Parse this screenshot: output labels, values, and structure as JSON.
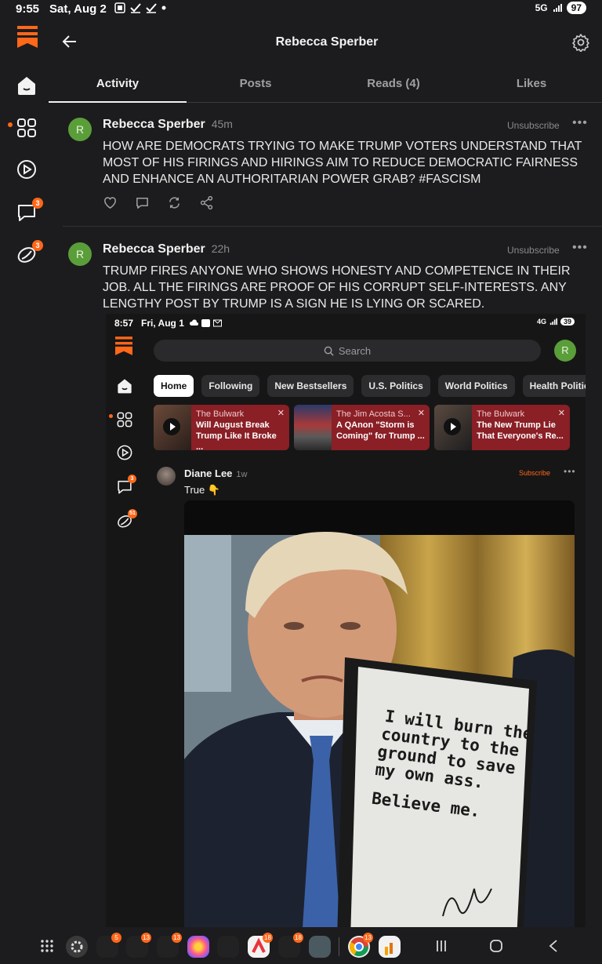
{
  "status_bar": {
    "time": "9:55",
    "date": "Sat, Aug 2",
    "network": "5G",
    "battery": "97"
  },
  "rail": {
    "badges": {
      "chat": "3",
      "activity": "3"
    }
  },
  "header": {
    "title": "Rebecca Sperber"
  },
  "tabs": [
    {
      "label": "Activity",
      "active": true
    },
    {
      "label": "Posts",
      "active": false
    },
    {
      "label": "Reads (4)",
      "active": false
    },
    {
      "label": "Likes",
      "active": false
    }
  ],
  "posts": [
    {
      "avatar_letter": "R",
      "author": "Rebecca Sperber",
      "time": "45m",
      "unsubscribe": "Unsubscribe",
      "more": "•••",
      "text": "HOW ARE DEMOCRATS TRYING TO MAKE TRUMP VOTERS UNDERSTAND THAT MOST OF HIS FIRINGS AND HIRINGS AIM TO REDUCE DEMOCRATIC FAIRNESS AND ENHANCE AN AUTHORITARIAN POWER GRAB? #FASCISM"
    },
    {
      "avatar_letter": "R",
      "author": "Rebecca Sperber",
      "time": "22h",
      "unsubscribe": "Unsubscribe",
      "more": "•••",
      "text": "TRUMP FIRES ANYONE WHO SHOWS HONESTY AND COMPETENCE IN THEIR JOB. ALL THE FIRINGS ARE PROOF OF HIS CORRUPT SELF-INTERESTS. ANY LENGTHY POST BY TRUMP IS A SIGN HE IS LYING OR SCARED."
    }
  ],
  "embedded": {
    "status": {
      "time": "8:57",
      "date": "Fri, Aug 1",
      "battery": "39",
      "network": "4G"
    },
    "search_placeholder": "Search",
    "avatar_letter": "R",
    "chips": [
      "Home",
      "Following",
      "New Bestsellers",
      "U.S. Politics",
      "World Politics",
      "Health Politic"
    ],
    "rail_badges": {
      "chat": "3",
      "activity": "51"
    },
    "cards": [
      {
        "source": "The Bulwark",
        "title": "Will August Break Trump Like It Broke ..."
      },
      {
        "source": "The Jim Acosta S...",
        "title": "A QAnon \"Storm is Coming\" for Trump ..."
      },
      {
        "source": "The Bulwark",
        "title": "The New Trump Lie That Everyone's Re..."
      }
    ],
    "note": {
      "author": "Diane Lee",
      "time": "1w",
      "subscribe": "Subscribe",
      "more": "•••",
      "text": "True 👇"
    },
    "sign_text": {
      "line1": "I will burn the",
      "line2": "country to the",
      "line3": "ground to save",
      "line4": "my own ass.",
      "line5": "Believe me."
    }
  },
  "nav_badges": [
    "5",
    "13",
    "13",
    "18",
    "18",
    "13"
  ],
  "colors": {
    "accent": "#ff6719",
    "background": "#1c1c1e",
    "avatar": "#5a9e3a",
    "card": "#8a1f26"
  }
}
